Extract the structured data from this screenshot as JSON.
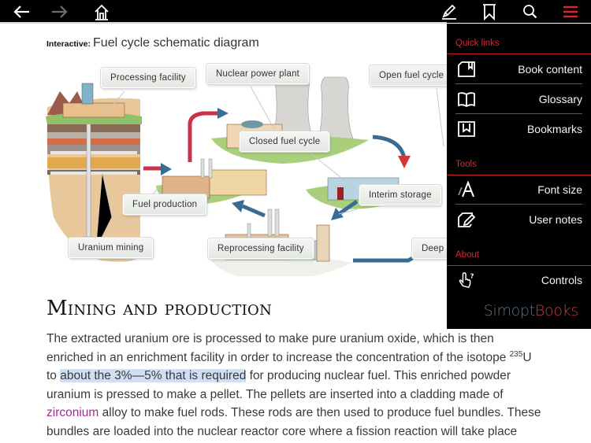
{
  "toolbar": {
    "icons": [
      "back-arrow-icon",
      "forward-arrow-icon",
      "home-icon",
      "annotate-pencil-icon",
      "bookmark-icon",
      "search-icon",
      "menu-icon"
    ],
    "forward_enabled": false,
    "menu_accent": "#d8262c"
  },
  "page": {
    "diagram_kicker": "Interactive:",
    "diagram_title": "Fuel cycle schematic diagram",
    "diagram_callouts": [
      {
        "label": "Processing facility"
      },
      {
        "label": "Nuclear power plant"
      },
      {
        "label": "Open fuel cycle"
      },
      {
        "label": "Closed fuel cycle"
      },
      {
        "label": "Fuel production"
      },
      {
        "label": "Interim storage"
      },
      {
        "label": "Uranium mining"
      },
      {
        "label": "Reprocessing facility"
      },
      {
        "label": "Deep r"
      }
    ],
    "section_heading": "Mining and production",
    "paragraph": {
      "l1": "The extracted uranium ore is processed to make pure uranium oxide, which is then",
      "l2_a": "enriched in an enrichment facility in order to increase the concentration of the isotope ",
      "l2_sup": "235",
      "l2_b": "U",
      "l3_a": "to ",
      "l3_highlight": "about the 3%—5% that is required",
      "l3_b": " for producing nuclear fuel. This enriched powder",
      "l4": "uranium is pressed to make a pellet. The pellets are inserted into a cladding made of",
      "l5_link": "zirconium",
      "l5_b": " alloy to make fuel rods. These rods are then used to produce fuel bundles. These",
      "l6": "bundles are loaded into the nuclear reactor core where a fission reaction will take place"
    },
    "highlight_color": "#cfe0f5",
    "link_color": "#9c2f8f"
  },
  "menu": {
    "sections": [
      {
        "title": "Quick links",
        "items": [
          {
            "label": "Book content",
            "icon": "book-content-icon"
          },
          {
            "label": "Glossary",
            "icon": "open-book-icon"
          },
          {
            "label": "Bookmarks",
            "icon": "bookmarks-icon"
          }
        ]
      },
      {
        "title": "Tools",
        "items": [
          {
            "label": "Font size",
            "icon": "font-size-icon"
          },
          {
            "label": "User notes",
            "icon": "user-notes-icon"
          }
        ]
      },
      {
        "title": "About",
        "items": [
          {
            "label": "Controls",
            "icon": "hand-question-icon"
          }
        ]
      }
    ],
    "brand_part1": "Simopt",
    "brand_part2": "Books"
  }
}
